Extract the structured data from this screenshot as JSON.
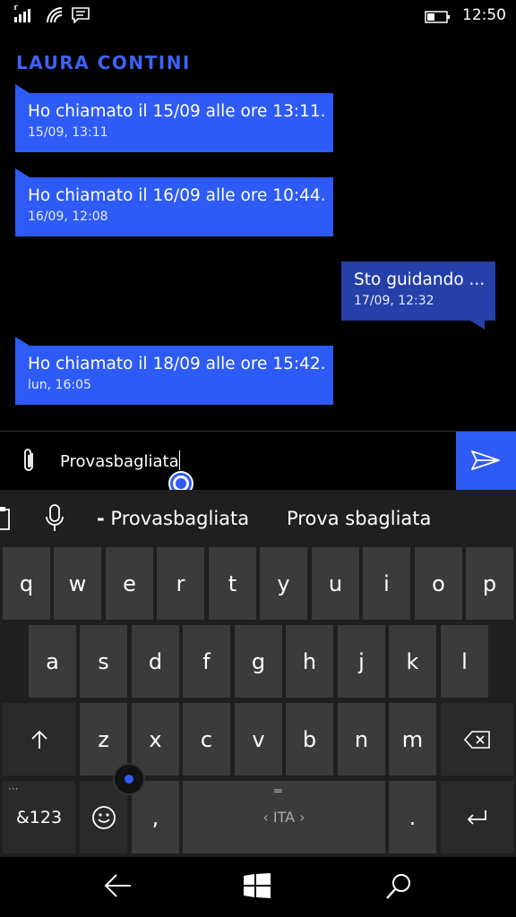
{
  "status_bar": {
    "time": "12:50",
    "icons": [
      "signal-icon",
      "wifi-icon",
      "message-icon",
      "battery-icon"
    ]
  },
  "contact": {
    "name": "LAURA CONTINI"
  },
  "messages": [
    {
      "direction": "in",
      "text": "Ho chiamato il 15/09 alle ore 13:11.",
      "time": "15/09, 13:11"
    },
    {
      "direction": "in",
      "text": "Ho chiamato il 16/09 alle ore 10:44.",
      "time": "16/09, 12:08"
    },
    {
      "direction": "out",
      "text": "Sto guidando ...",
      "time": "17/09, 12:32"
    },
    {
      "direction": "in",
      "text": "Ho chiamato il 18/09 alle ore 15:42.",
      "time": "lun, 16:05"
    }
  ],
  "compose": {
    "value": "Provasbagliata"
  },
  "suggestions": [
    "Provasbagliata",
    "Prova sbagliata"
  ],
  "keyboard": {
    "row1": [
      "q",
      "w",
      "e",
      "r",
      "t",
      "y",
      "u",
      "i",
      "o",
      "p"
    ],
    "row2": [
      "a",
      "s",
      "d",
      "f",
      "g",
      "h",
      "j",
      "k",
      "l"
    ],
    "row3": [
      "z",
      "x",
      "c",
      "v",
      "b",
      "n",
      "m"
    ],
    "numbers_label": "&123",
    "comma": ",",
    "space_label": "‹ ITA ›",
    "period": "."
  },
  "colors": {
    "accent": "#2e5bf5",
    "outgoing": "#2540a8",
    "key": "#3b3b3b"
  }
}
